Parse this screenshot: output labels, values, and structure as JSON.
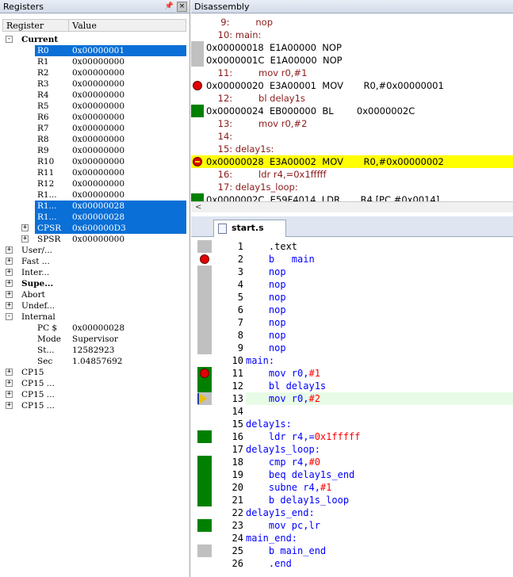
{
  "registers": {
    "title": "Registers",
    "columns": {
      "register": "Register",
      "value": "Value"
    },
    "rows": [
      {
        "name": "Current",
        "value": "",
        "bold": true,
        "indent": 0,
        "expander": "-"
      },
      {
        "name": "R0",
        "value": "0x00000001",
        "indent": 2,
        "sel": true
      },
      {
        "name": "R1",
        "value": "0x00000000",
        "indent": 2
      },
      {
        "name": "R2",
        "value": "0x00000000",
        "indent": 2
      },
      {
        "name": "R3",
        "value": "0x00000000",
        "indent": 2
      },
      {
        "name": "R4",
        "value": "0x00000000",
        "indent": 2
      },
      {
        "name": "R5",
        "value": "0x00000000",
        "indent": 2
      },
      {
        "name": "R6",
        "value": "0x00000000",
        "indent": 2
      },
      {
        "name": "R7",
        "value": "0x00000000",
        "indent": 2
      },
      {
        "name": "R8",
        "value": "0x00000000",
        "indent": 2
      },
      {
        "name": "R9",
        "value": "0x00000000",
        "indent": 2
      },
      {
        "name": "R10",
        "value": "0x00000000",
        "indent": 2
      },
      {
        "name": "R11",
        "value": "0x00000000",
        "indent": 2
      },
      {
        "name": "R12",
        "value": "0x00000000",
        "indent": 2
      },
      {
        "name": "R1...",
        "value": "0x00000000",
        "indent": 2
      },
      {
        "name": "R1...",
        "value": "0x00000028",
        "indent": 2,
        "sel": true
      },
      {
        "name": "R1...",
        "value": "0x00000028",
        "indent": 2,
        "sel": true
      },
      {
        "name": "CPSR",
        "value": "0x600000D3",
        "indent": 2,
        "sel": true,
        "expander": "+"
      },
      {
        "name": "SPSR",
        "value": "0x00000000",
        "indent": 2,
        "expander": "+"
      },
      {
        "name": "User/...",
        "value": "",
        "indent": 0,
        "expander": "+"
      },
      {
        "name": "Fast ...",
        "value": "",
        "indent": 0,
        "expander": "+"
      },
      {
        "name": "Inter...",
        "value": "",
        "indent": 0,
        "expander": "+"
      },
      {
        "name": "Supe...",
        "value": "",
        "bold": true,
        "indent": 0,
        "expander": "+"
      },
      {
        "name": "Abort",
        "value": "",
        "indent": 0,
        "expander": "+"
      },
      {
        "name": "Undef...",
        "value": "",
        "indent": 0,
        "expander": "+"
      },
      {
        "name": "Internal",
        "value": "",
        "indent": 0,
        "expander": "-"
      },
      {
        "name": "PC  $",
        "value": "0x00000028",
        "indent": 2
      },
      {
        "name": "Mode",
        "value": "Supervisor",
        "indent": 2
      },
      {
        "name": "St...",
        "value": "12582923",
        "indent": 2
      },
      {
        "name": "Sec",
        "value": "1.04857692",
        "indent": 2
      },
      {
        "name": "CP15",
        "value": "",
        "indent": 0,
        "expander": "+"
      },
      {
        "name": "CP15 ...",
        "value": "",
        "indent": 0,
        "expander": "+"
      },
      {
        "name": "CP15 ...",
        "value": "",
        "indent": 0,
        "expander": "+"
      },
      {
        "name": "CP15 ...",
        "value": "",
        "indent": 0,
        "expander": "+"
      }
    ]
  },
  "disassembly": {
    "title": "Disassembly",
    "lines": [
      {
        "text": "     9:         nop",
        "kind": "src",
        "gutter": "none"
      },
      {
        "text": "    10: main:",
        "kind": "src",
        "gutter": "none"
      },
      {
        "text": "0x00000018  E1A00000  NOP",
        "kind": "asm",
        "gutter": "gray"
      },
      {
        "text": "0x0000001C  E1A00000  NOP",
        "kind": "asm",
        "gutter": "gray"
      },
      {
        "text": "    11:         mov r0,#1",
        "kind": "src",
        "gutter": "none"
      },
      {
        "text": "0x00000020  E3A00001  MOV       R0,#0x00000001",
        "kind": "asm",
        "gutter": "bp"
      },
      {
        "text": "    12:         bl delay1s",
        "kind": "src",
        "gutter": "none"
      },
      {
        "text": "0x00000024  EB000000  BL        0x0000002C",
        "kind": "asm",
        "gutter": "green"
      },
      {
        "text": "    13:         mov r0,#2",
        "kind": "src",
        "gutter": "none"
      },
      {
        "text": "    14:",
        "kind": "src",
        "gutter": "none"
      },
      {
        "text": "    15: delay1s:",
        "kind": "src",
        "gutter": "none"
      },
      {
        "text": "0x00000028  E3A00002  MOV       R0,#0x00000002",
        "kind": "asm",
        "gutter": "pc",
        "current": true
      },
      {
        "text": "    16:         ldr r4,=0x1fffff",
        "kind": "src",
        "gutter": "none"
      },
      {
        "text": "    17: delay1s_loop:",
        "kind": "src",
        "gutter": "none"
      },
      {
        "text": "0x0000002C  E59F4014  LDR       R4,[PC,#0x0014]",
        "kind": "asm",
        "gutter": "green"
      }
    ],
    "scroll_left": "<"
  },
  "editor": {
    "tab_label": "start.s",
    "lines": [
      {
        "n": "1",
        "mark": "gray",
        "parts": [
          {
            "t": "    .text",
            "c": "plain"
          }
        ]
      },
      {
        "n": "2",
        "mark": "bp",
        "parts": [
          {
            "t": "    b   main",
            "c": "kw"
          }
        ]
      },
      {
        "n": "3",
        "mark": "gray",
        "parts": [
          {
            "t": "    nop",
            "c": "kw"
          }
        ]
      },
      {
        "n": "4",
        "mark": "gray",
        "parts": [
          {
            "t": "    nop",
            "c": "kw"
          }
        ]
      },
      {
        "n": "5",
        "mark": "gray",
        "parts": [
          {
            "t": "    nop",
            "c": "kw"
          }
        ]
      },
      {
        "n": "6",
        "mark": "gray",
        "parts": [
          {
            "t": "    nop",
            "c": "kw"
          }
        ]
      },
      {
        "n": "7",
        "mark": "gray",
        "parts": [
          {
            "t": "    nop",
            "c": "kw"
          }
        ]
      },
      {
        "n": "8",
        "mark": "gray",
        "parts": [
          {
            "t": "    nop",
            "c": "kw"
          }
        ]
      },
      {
        "n": "9",
        "mark": "gray",
        "parts": [
          {
            "t": "    nop",
            "c": "kw"
          }
        ]
      },
      {
        "n": "10",
        "mark": "none",
        "parts": [
          {
            "t": "main:",
            "c": "lbl"
          }
        ]
      },
      {
        "n": "11",
        "mark": "greenbp",
        "parts": [
          {
            "t": "    mov r0,",
            "c": "kw"
          },
          {
            "t": "#1",
            "c": "num"
          }
        ]
      },
      {
        "n": "12",
        "mark": "green",
        "parts": [
          {
            "t": "    bl delay1s",
            "c": "kw"
          }
        ]
      },
      {
        "n": "13",
        "mark": "pc",
        "current": true,
        "parts": [
          {
            "t": "    mov r0,",
            "c": "kw"
          },
          {
            "t": "#2",
            "c": "num"
          }
        ]
      },
      {
        "n": "14",
        "mark": "none",
        "parts": [
          {
            "t": "",
            "c": "plain"
          }
        ]
      },
      {
        "n": "15",
        "mark": "none",
        "parts": [
          {
            "t": "delay1s:",
            "c": "lbl"
          }
        ]
      },
      {
        "n": "16",
        "mark": "green",
        "parts": [
          {
            "t": "    ldr r4,=",
            "c": "kw"
          },
          {
            "t": "0x1fffff",
            "c": "num"
          }
        ]
      },
      {
        "n": "17",
        "mark": "none",
        "parts": [
          {
            "t": "delay1s_loop:",
            "c": "lbl"
          }
        ]
      },
      {
        "n": "18",
        "mark": "green",
        "parts": [
          {
            "t": "    cmp r4,",
            "c": "kw"
          },
          {
            "t": "#0",
            "c": "num"
          }
        ]
      },
      {
        "n": "19",
        "mark": "green",
        "parts": [
          {
            "t": "    beq delay1s_end",
            "c": "kw"
          }
        ]
      },
      {
        "n": "20",
        "mark": "green",
        "parts": [
          {
            "t": "    subne r4,",
            "c": "kw"
          },
          {
            "t": "#1",
            "c": "num"
          }
        ]
      },
      {
        "n": "21",
        "mark": "green",
        "parts": [
          {
            "t": "    b delay1s_loop",
            "c": "kw"
          }
        ]
      },
      {
        "n": "22",
        "mark": "none",
        "parts": [
          {
            "t": "delay1s_end:",
            "c": "lbl"
          }
        ]
      },
      {
        "n": "23",
        "mark": "green",
        "parts": [
          {
            "t": "    mov pc,lr",
            "c": "kw"
          }
        ]
      },
      {
        "n": "24",
        "mark": "none",
        "parts": [
          {
            "t": "main_end:",
            "c": "lbl"
          }
        ]
      },
      {
        "n": "25",
        "mark": "gray",
        "parts": [
          {
            "t": "    b main_end",
            "c": "kw"
          }
        ]
      },
      {
        "n": "26",
        "mark": "none",
        "parts": [
          {
            "t": "    .end",
            "c": "kw"
          }
        ]
      }
    ]
  }
}
